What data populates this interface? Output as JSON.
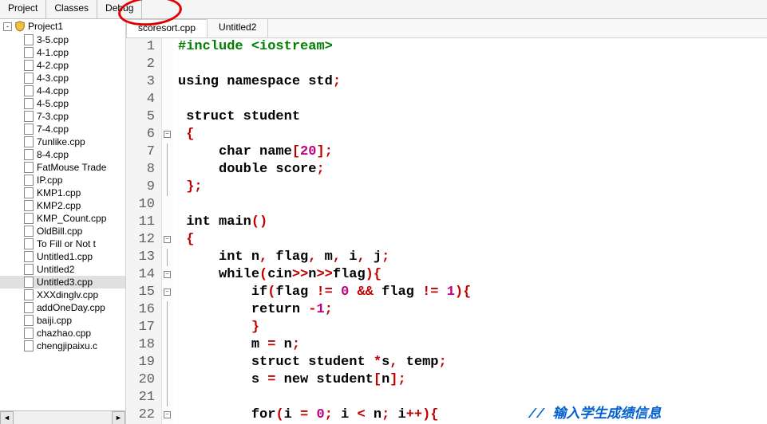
{
  "topTabs": [
    "Project",
    "Classes",
    "Debug"
  ],
  "project": {
    "name": "Project1",
    "files": [
      "3-5.cpp",
      "4-1.cpp",
      "4-2.cpp",
      "4-3.cpp",
      "4-4.cpp",
      "4-5.cpp",
      "7-3.cpp",
      "7-4.cpp",
      "7unlike.cpp",
      "8-4.cpp",
      "FatMouse Trade",
      "IP.cpp",
      "KMP1.cpp",
      "KMP2.cpp",
      "KMP_Count.cpp",
      "OldBill.cpp",
      "To Fill or Not t",
      "Untitled1.cpp",
      "Untitled2",
      "Untitled3.cpp",
      "XXXdinglv.cpp",
      "addOneDay.cpp",
      "baiji.cpp",
      "chazhao.cpp",
      "chengjipaixu.c"
    ]
  },
  "selectedFile": "Untitled3.cpp",
  "fileTabs": [
    {
      "label": "scoresort.cpp",
      "active": true,
      "circled": true
    },
    {
      "label": "Untitled2",
      "active": false,
      "circled": false
    }
  ],
  "code": {
    "lines": [
      {
        "n": 1,
        "fold": null,
        "seg": [
          {
            "c": "pp",
            "t": "#include "
          },
          {
            "c": "pp",
            "t": "<iostream>"
          }
        ]
      },
      {
        "n": 2,
        "fold": null,
        "seg": []
      },
      {
        "n": 3,
        "fold": null,
        "seg": [
          {
            "c": "kw",
            "t": "using namespace"
          },
          {
            "c": "nm",
            "t": " std"
          },
          {
            "c": "op",
            "t": ";"
          }
        ]
      },
      {
        "n": 4,
        "fold": null,
        "seg": []
      },
      {
        "n": 5,
        "fold": null,
        "seg": [
          {
            "c": "nm",
            "t": " "
          },
          {
            "c": "kw",
            "t": "struct"
          },
          {
            "c": "nm",
            "t": " student"
          }
        ]
      },
      {
        "n": 6,
        "fold": "minus",
        "seg": [
          {
            "c": "nm",
            "t": " "
          },
          {
            "c": "op",
            "t": "{"
          }
        ]
      },
      {
        "n": 7,
        "fold": "line",
        "seg": [
          {
            "c": "nm",
            "t": "     "
          },
          {
            "c": "kw",
            "t": "char"
          },
          {
            "c": "nm",
            "t": " name"
          },
          {
            "c": "op",
            "t": "["
          },
          {
            "c": "num",
            "t": "20"
          },
          {
            "c": "op",
            "t": "];"
          }
        ]
      },
      {
        "n": 8,
        "fold": "line",
        "seg": [
          {
            "c": "nm",
            "t": "     "
          },
          {
            "c": "kw",
            "t": "double"
          },
          {
            "c": "nm",
            "t": " score"
          },
          {
            "c": "op",
            "t": ";"
          }
        ]
      },
      {
        "n": 9,
        "fold": "end",
        "seg": [
          {
            "c": "nm",
            "t": " "
          },
          {
            "c": "op",
            "t": "};"
          }
        ]
      },
      {
        "n": 10,
        "fold": null,
        "seg": []
      },
      {
        "n": 11,
        "fold": null,
        "seg": [
          {
            "c": "nm",
            "t": " "
          },
          {
            "c": "kw",
            "t": "int"
          },
          {
            "c": "nm",
            "t": " main"
          },
          {
            "c": "op",
            "t": "()"
          }
        ]
      },
      {
        "n": 12,
        "fold": "minus",
        "seg": [
          {
            "c": "nm",
            "t": " "
          },
          {
            "c": "op",
            "t": "{"
          }
        ]
      },
      {
        "n": 13,
        "fold": "line",
        "seg": [
          {
            "c": "nm",
            "t": "     "
          },
          {
            "c": "kw",
            "t": "int"
          },
          {
            "c": "nm",
            "t": " n"
          },
          {
            "c": "op",
            "t": ","
          },
          {
            "c": "nm",
            "t": " flag"
          },
          {
            "c": "op",
            "t": ","
          },
          {
            "c": "nm",
            "t": " m"
          },
          {
            "c": "op",
            "t": ","
          },
          {
            "c": "nm",
            "t": " i"
          },
          {
            "c": "op",
            "t": ","
          },
          {
            "c": "nm",
            "t": " j"
          },
          {
            "c": "op",
            "t": ";"
          }
        ]
      },
      {
        "n": 14,
        "fold": "minus",
        "seg": [
          {
            "c": "nm",
            "t": "     "
          },
          {
            "c": "kw",
            "t": "while"
          },
          {
            "c": "op",
            "t": "("
          },
          {
            "c": "nm",
            "t": "cin"
          },
          {
            "c": "op",
            "t": ">>"
          },
          {
            "c": "nm",
            "t": "n"
          },
          {
            "c": "op",
            "t": ">>"
          },
          {
            "c": "nm",
            "t": "flag"
          },
          {
            "c": "op",
            "t": "){"
          }
        ]
      },
      {
        "n": 15,
        "fold": "minus",
        "seg": [
          {
            "c": "nm",
            "t": "         "
          },
          {
            "c": "kw",
            "t": "if"
          },
          {
            "c": "op",
            "t": "("
          },
          {
            "c": "nm",
            "t": "flag "
          },
          {
            "c": "op",
            "t": "!="
          },
          {
            "c": "nm",
            "t": " "
          },
          {
            "c": "num",
            "t": "0"
          },
          {
            "c": "nm",
            "t": " "
          },
          {
            "c": "op",
            "t": "&&"
          },
          {
            "c": "nm",
            "t": " flag "
          },
          {
            "c": "op",
            "t": "!="
          },
          {
            "c": "nm",
            "t": " "
          },
          {
            "c": "num",
            "t": "1"
          },
          {
            "c": "op",
            "t": "){"
          }
        ]
      },
      {
        "n": 16,
        "fold": "line",
        "seg": [
          {
            "c": "nm",
            "t": "         "
          },
          {
            "c": "kw",
            "t": "return"
          },
          {
            "c": "nm",
            "t": " "
          },
          {
            "c": "op",
            "t": "-"
          },
          {
            "c": "num",
            "t": "1"
          },
          {
            "c": "op",
            "t": ";"
          }
        ]
      },
      {
        "n": 17,
        "fold": "end",
        "seg": [
          {
            "c": "nm",
            "t": "         "
          },
          {
            "c": "op",
            "t": "}"
          }
        ]
      },
      {
        "n": 18,
        "fold": "line",
        "seg": [
          {
            "c": "nm",
            "t": "         m "
          },
          {
            "c": "op",
            "t": "="
          },
          {
            "c": "nm",
            "t": " n"
          },
          {
            "c": "op",
            "t": ";"
          }
        ]
      },
      {
        "n": 19,
        "fold": "line",
        "seg": [
          {
            "c": "nm",
            "t": "         "
          },
          {
            "c": "kw",
            "t": "struct"
          },
          {
            "c": "nm",
            "t": " student "
          },
          {
            "c": "op",
            "t": "*"
          },
          {
            "c": "nm",
            "t": "s"
          },
          {
            "c": "op",
            "t": ","
          },
          {
            "c": "nm",
            "t": " temp"
          },
          {
            "c": "op",
            "t": ";"
          }
        ]
      },
      {
        "n": 20,
        "fold": "line",
        "seg": [
          {
            "c": "nm",
            "t": "         s "
          },
          {
            "c": "op",
            "t": "="
          },
          {
            "c": "nm",
            "t": " "
          },
          {
            "c": "kw",
            "t": "new"
          },
          {
            "c": "nm",
            "t": " student"
          },
          {
            "c": "op",
            "t": "["
          },
          {
            "c": "nm",
            "t": "n"
          },
          {
            "c": "op",
            "t": "];"
          }
        ]
      },
      {
        "n": 21,
        "fold": "line",
        "seg": []
      },
      {
        "n": 22,
        "fold": "minus",
        "seg": [
          {
            "c": "nm",
            "t": "         "
          },
          {
            "c": "kw",
            "t": "for"
          },
          {
            "c": "op",
            "t": "("
          },
          {
            "c": "nm",
            "t": "i "
          },
          {
            "c": "op",
            "t": "="
          },
          {
            "c": "nm",
            "t": " "
          },
          {
            "c": "num",
            "t": "0"
          },
          {
            "c": "op",
            "t": ";"
          },
          {
            "c": "nm",
            "t": " i "
          },
          {
            "c": "op",
            "t": "<"
          },
          {
            "c": "nm",
            "t": " n"
          },
          {
            "c": "op",
            "t": ";"
          },
          {
            "c": "nm",
            "t": " i"
          },
          {
            "c": "op",
            "t": "++){"
          },
          {
            "c": "nm",
            "t": "           "
          },
          {
            "c": "cm",
            "t": "// 输入学生成绩信息"
          }
        ]
      }
    ]
  }
}
